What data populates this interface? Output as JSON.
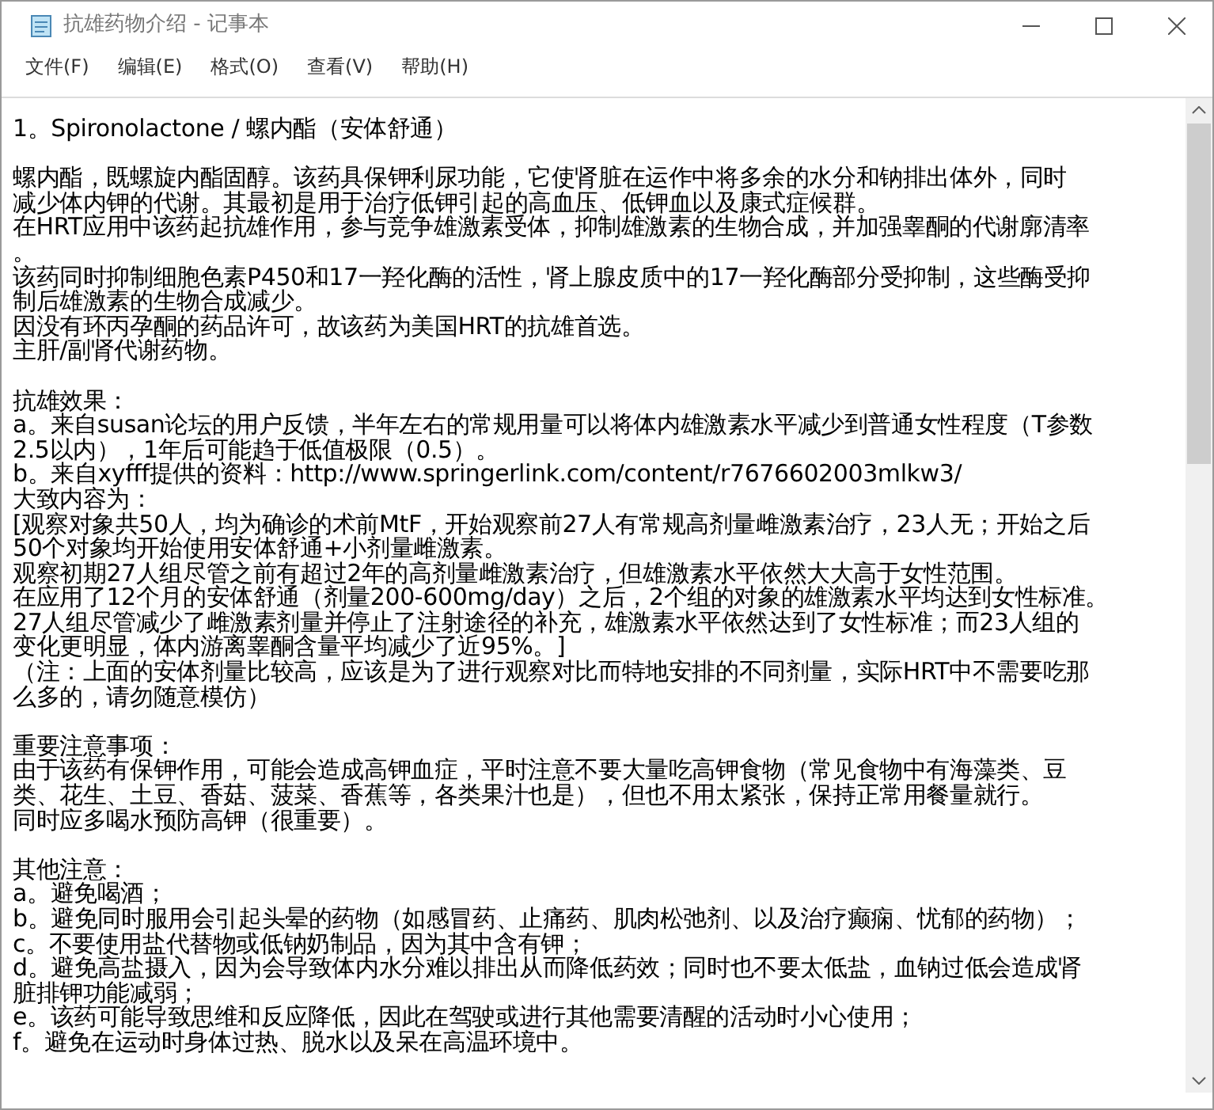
{
  "window": {
    "title": "抗雄药物介绍 - 记事本"
  },
  "menu": [
    "文件(F)",
    "编辑(E)",
    "格式(O)",
    "查看(V)",
    "帮助(H)"
  ],
  "document": {
    "blocks": [
      {
        "lines": [
          "1。Spironolactone / 螺内酯（安体舒通）"
        ]
      },
      {
        "lines": [
          "螺内酯，既螺旋内酯固醇。该药具保钾利尿功能，它使肾脏在运作中将多余的水分和钠排出体外，同时",
          "减少体内钾的代谢。其最初是用于治疗低钾引起的高血压、低钾血以及康式症候群。",
          "在HRT应用中该药起抗雄作用，参与竞争雄激素受体，抑制雄激素的生物合成，并加强睾酮的代谢廓清率",
          "。",
          "该药同时抑制细胞色素P450和17一羟化酶的活性，肾上腺皮质中的17一羟化酶部分受抑制，这些酶受抑",
          "制后雄激素的生物合成减少。",
          "因没有环丙孕酮的药品许可，故该药为美国HRT的抗雄首选。",
          "主肝/副肾代谢药物。"
        ]
      },
      {
        "lines": [
          "抗雄效果：",
          "a。来自susan论坛的用户反馈，半年左右的常规用量可以将体内雄激素水平减少到普通女性程度（T参数",
          "2.5以内），1年后可能趋于低值极限（0.5）。",
          "b。来自xyfff提供的资料：http://www.springerlink.com/content/r7676602003mlkw3/",
          "大致内容为：",
          "[观察对象共50人，均为确诊的术前MtF，开始观察前27人有常规高剂量雌激素治疗，23人无；开始之后",
          "50个对象均开始使用安体舒通+小剂量雌激素。",
          "观察初期27人组尽管之前有超过2年的高剂量雌激素治疗，但雄激素水平依然大大高于女性范围。",
          "在应用了12个月的安体舒通（剂量200-600mg/day）之后，2个组的对象的雄激素水平均达到女性标准。",
          "27人组尽管减少了雌激素剂量并停止了注射途径的补充，雄激素水平依然达到了女性标准；而23人组的",
          "变化更明显，体内游离睾酮含量平均减少了近95%。]",
          "（注：上面的安体剂量比较高，应该是为了进行观察对比而特地安排的不同剂量，实际HRT中不需要吃那",
          "么多的，请勿随意模仿）"
        ]
      },
      {
        "lines": [
          "重要注意事项：",
          "由于该药有保钾作用，可能会造成高钾血症，平时注意不要大量吃高钾食物（常见食物中有海藻类、豆",
          "类、花生、土豆、香菇、菠菜、香蕉等，各类果汁也是），但也不用太紧张，保持正常用餐量就行。",
          "同时应多喝水预防高钾（很重要）。"
        ]
      },
      {
        "lines": [
          "其他注意：",
          "a。避免喝酒；",
          "b。避免同时服用会引起头晕的药物（如感冒药、止痛药、肌肉松弛剂、以及治疗癫痫、忧郁的药物）；",
          "c。不要使用盐代替物或低钠奶制品，因为其中含有钾；",
          "d。避免高盐摄入，因为会导致体内水分难以排出从而降低药效；同时也不要太低盐，血钠过低会造成肾",
          "脏排钾功能减弱；",
          "e。该药可能导致思维和反应降低，因此在驾驶或进行其他需要清醒的活动时小心使用；",
          "f。避免在运动时身体过热、脱水以及呆在高温环境中。"
        ]
      }
    ]
  }
}
